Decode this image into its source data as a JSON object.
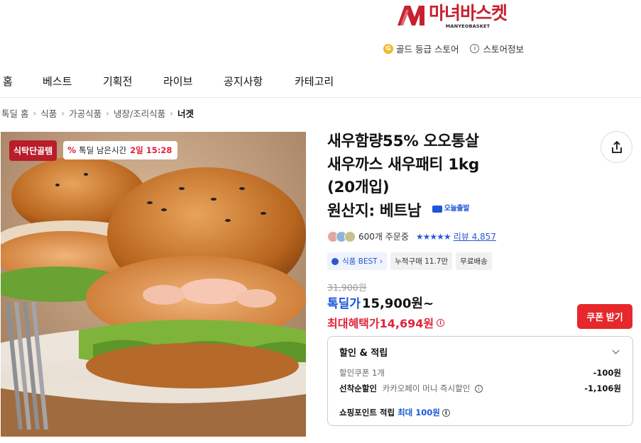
{
  "store": {
    "logo_title": "마녀바스켓",
    "logo_sub": "MANYEOBASKET",
    "grade_badge": "G",
    "grade_text": "골드 등급 스토어",
    "info_text": "스토어정보"
  },
  "nav": [
    "홈",
    "베스트",
    "기획전",
    "라이브",
    "공지사항",
    "카테고리"
  ],
  "breadcrumb": [
    "톡딜 홈",
    "식품",
    "가공식품",
    "냉장/조리식품",
    "너겟"
  ],
  "image": {
    "badge_special": "식탁단골템",
    "timer_pct": "%",
    "timer_label": "톡딜 남은시간",
    "timer_value": "2일 15:28"
  },
  "product": {
    "title_lines": [
      "새우함량55% 오오통살",
      "새우까스 새우패티 1kg",
      "(20개입)",
      "원산지: 베트남"
    ],
    "express_badge": "오늘출발",
    "orders": "600개 주문중",
    "stars": "★★★★★",
    "review": "리뷰 4,857",
    "tags": [
      "식품 BEST ›",
      "누적구매 11.7만",
      "무료배송"
    ],
    "price_original": "31,900원",
    "price_label": "톡딜가",
    "price_value": "15,900원~",
    "max_label": "최대혜택가",
    "max_value": "14,694원",
    "coupon_button": "쿠폰 받기"
  },
  "benefits": {
    "header": "할인 & 적립",
    "coupon_label": "할인쿠폰 1개",
    "coupon_amount": "-100원",
    "first_label": "선착순할인",
    "first_desc": "카카오페이 머니 즉시할인",
    "first_amount": "-1,106원",
    "point_label": "쇼핑포인트 적립",
    "point_value": "최대 100원"
  },
  "colors": {
    "brand_red": "#c8202f",
    "price_blue": "#1b57d8",
    "discount_red": "#e0243a",
    "coupon_button": "#e6282c"
  }
}
